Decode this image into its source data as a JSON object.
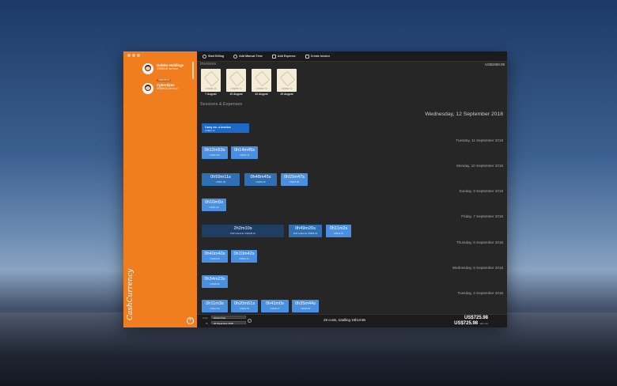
{
  "toolbar": {
    "start_billing": "Start Billing",
    "add_manual_time": "Add Manual Time",
    "add_expense": "Add Expense",
    "create_invoice": "Create Invoice"
  },
  "sidebar": {
    "clients": [
      {
        "name": "Galaks Holdings",
        "rate": "US$68.00 per hour",
        "badge": "US$1658.09"
      },
      {
        "name": "Cyberdyne",
        "rate": "US$68.00 per hour"
      }
    ],
    "logo": "CashCurrency"
  },
  "invoices": {
    "title": "Invoices",
    "total": "US$1658.09",
    "items": [
      {
        "amount": "US$481.48",
        "date": "7 August"
      },
      {
        "amount": "US$286.70",
        "date": "15 August"
      },
      {
        "amount": "US$384.78",
        "date": "22 August"
      },
      {
        "amount": "US$502.20",
        "date": "29 August"
      }
    ]
  },
  "sessions": {
    "title": "Sessions & Expenses",
    "days": [
      {
        "label": "Wednesday, 12 September 2018"
      },
      {
        "label": "Tuesday, 11 September 2018"
      },
      {
        "label": "Monday, 10 September 2018"
      },
      {
        "label": "Sunday, 9 September 2018"
      },
      {
        "label": "Friday, 7 September 2018"
      },
      {
        "label": "Thursday, 6 September 2018"
      },
      {
        "label": "Wednesday, 5 September 2018"
      },
      {
        "label": "Tuesday, 4 September 2018"
      }
    ],
    "carry": {
      "title": "Carry ov...s invoice",
      "amount": "US$84.75"
    },
    "items": {
      "tue_1": {
        "dur": "0h12m53s",
        "amt": "US$14.60"
      },
      "tue_2": {
        "dur": "0h14m45s",
        "amt": "US$16.72"
      },
      "mon_1": {
        "dur": "0h59m11s",
        "amt": "US$67.06"
      },
      "mon_2": {
        "dur": "0h48m45s",
        "amt": "US$55.25"
      },
      "mon_3": {
        "dur": "0h15m47s",
        "amt": "US$17.89"
      },
      "sun_1": {
        "dur": "0h10m5s",
        "amt": "US$11.43"
      },
      "fri_1": {
        "dur": "2h2m10s",
        "amt": "PHP Adwords US$138.44"
      },
      "fri_2": {
        "dur": "0h49m26s",
        "amt": "PHP Adwords US$56.02"
      },
      "fri_3": {
        "dur": "0h11m2s",
        "amt": "US$12.51"
      },
      "thu_1": {
        "dur": "0h40m40s",
        "amt": "US$46.09"
      },
      "thu_2": {
        "dur": "0h10m42s",
        "amt": "US$12.13"
      },
      "wed_1": {
        "dur": "0h34m23s",
        "amt": "US$38.96"
      },
      "tue4_1": {
        "dur": "0h11m3s",
        "amt": "US$12.52"
      },
      "tue4_2": {
        "dur": "0h20m51s",
        "amt": "US$23.63"
      },
      "tue4_3": {
        "dur": "0h41m0s",
        "amt": "US$46.47"
      },
      "tue4_4": {
        "dur": "0h35m44s",
        "amt": "US$40.50"
      }
    }
  },
  "footer": {
    "from_label": "From",
    "from_value": "Distant Past",
    "to_label": "To",
    "to_value": "26 September 2018",
    "summary": "28 costs, totalling 16h1m8s",
    "total_1": "US$725.98",
    "total_2": "US$725.98",
    "total_2_note": "after tax"
  }
}
